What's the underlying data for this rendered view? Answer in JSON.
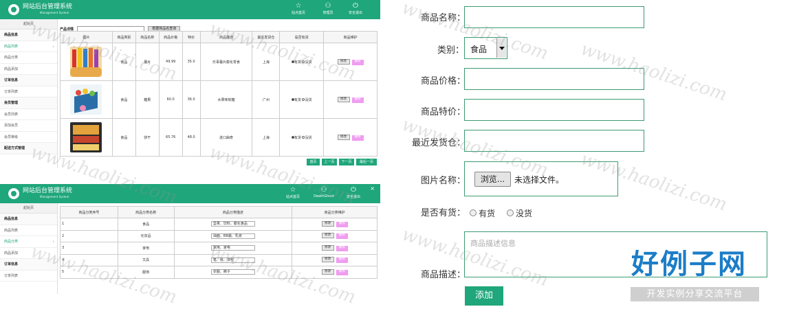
{
  "app": {
    "brand_title": "网站后台管理系统",
    "brand_subtitle": "Management System",
    "top_buttons": [
      "站点首页",
      "管理员",
      "安全退出"
    ],
    "top_buttons_b": [
      "站点首页",
      "DeathGhost",
      "安全退出"
    ],
    "window_close": "×",
    "colors": {
      "primary": "#1fa67a",
      "delete": "#f09cf0",
      "form_border": "#3b9a72",
      "logo_blue": "#1c7dc7"
    }
  },
  "sidebar_a": {
    "home": "起始页",
    "items": [
      {
        "label": "商品信息",
        "head": true
      },
      {
        "label": "商品列表",
        "active": true
      },
      {
        "label": "商品分类"
      },
      {
        "label": "商品添加"
      },
      {
        "label": "订单信息",
        "head": true
      },
      {
        "label": "订单列表"
      },
      {
        "label": "会员管理",
        "head": true
      },
      {
        "label": "会员列表"
      },
      {
        "label": "添加会员"
      },
      {
        "label": "会员等级"
      },
      {
        "label": "配送方式管理",
        "head": true
      }
    ]
  },
  "sidebar_b": {
    "home": "起始页",
    "items": [
      {
        "label": "商品信息",
        "head": true
      },
      {
        "label": "商品列表"
      },
      {
        "label": "商品分类",
        "active": true
      },
      {
        "label": "商品添加"
      },
      {
        "label": "订单信息",
        "head": true
      },
      {
        "label": "订单列表"
      }
    ]
  },
  "product_list": {
    "search_label": "产品详情",
    "search_button": "根据商品名查询",
    "columns": [
      "图片",
      "商品类别",
      "商品名称",
      "商品价格",
      "特价",
      "商品描述",
      "最近发货仓",
      "是否有货",
      "商品维护"
    ],
    "rows": [
      {
        "category": "食品",
        "name": "薯片",
        "price": "49.99",
        "special": "35.0",
        "desc": "乐事薯片膨化零食",
        "warehouse": "上海",
        "stock_yes": "有货",
        "stock_no": "没货",
        "in_stock": true
      },
      {
        "category": "食品",
        "name": "糖果",
        "price": "60.0",
        "special": "36.0",
        "desc": "水果味软糖",
        "warehouse": "广州",
        "stock_yes": "有货",
        "stock_no": "没货",
        "in_stock": true
      },
      {
        "category": "食品",
        "name": "饼干",
        "price": "65.76",
        "special": "48.0",
        "desc": "进口曲奇",
        "warehouse": "上海",
        "stock_yes": "有货",
        "stock_no": "没货",
        "in_stock": true
      }
    ],
    "edit_label": "修改",
    "delete_label": "删除",
    "pager": [
      "首页",
      "上一页",
      "下一页",
      "最后一页"
    ]
  },
  "category_list": {
    "columns": [
      "商品分类序号",
      "商品分类名称",
      "商品分类描述",
      "商品分类维护"
    ],
    "rows": [
      {
        "no": "1",
        "name": "食品",
        "desc": "坚果、饮料、膨化食品"
      },
      {
        "no": "2",
        "name": "化妆品",
        "desc": "油面、BB霜、乳液"
      },
      {
        "no": "3",
        "name": "家电",
        "desc": "家用、家电"
      },
      {
        "no": "4",
        "name": "文具",
        "desc": "笔、纸、书包"
      },
      {
        "no": "5",
        "name": "服饰",
        "desc": "衣服、裤子"
      }
    ],
    "edit_label": "修改",
    "delete_label": "删除"
  },
  "form": {
    "name_label": "商品名称：",
    "category_label": "类别：",
    "category_value": "食品",
    "price_label": "商品价格：",
    "special_label": "商品特价：",
    "warehouse_label": "最近发货仓：",
    "image_label": "图片名称：",
    "browse_button": "浏览...",
    "no_file_text": "未选择文件。",
    "stock_label": "是否有货：",
    "stock_yes": "有货",
    "stock_no": "没货",
    "desc_label": "商品描述：",
    "desc_placeholder": "商品描述信息",
    "submit": "添加"
  },
  "watermark": {
    "text": "www.haolizi.com",
    "logo_main": "好例子网",
    "logo_sub": "开发实例分享交流平台"
  }
}
